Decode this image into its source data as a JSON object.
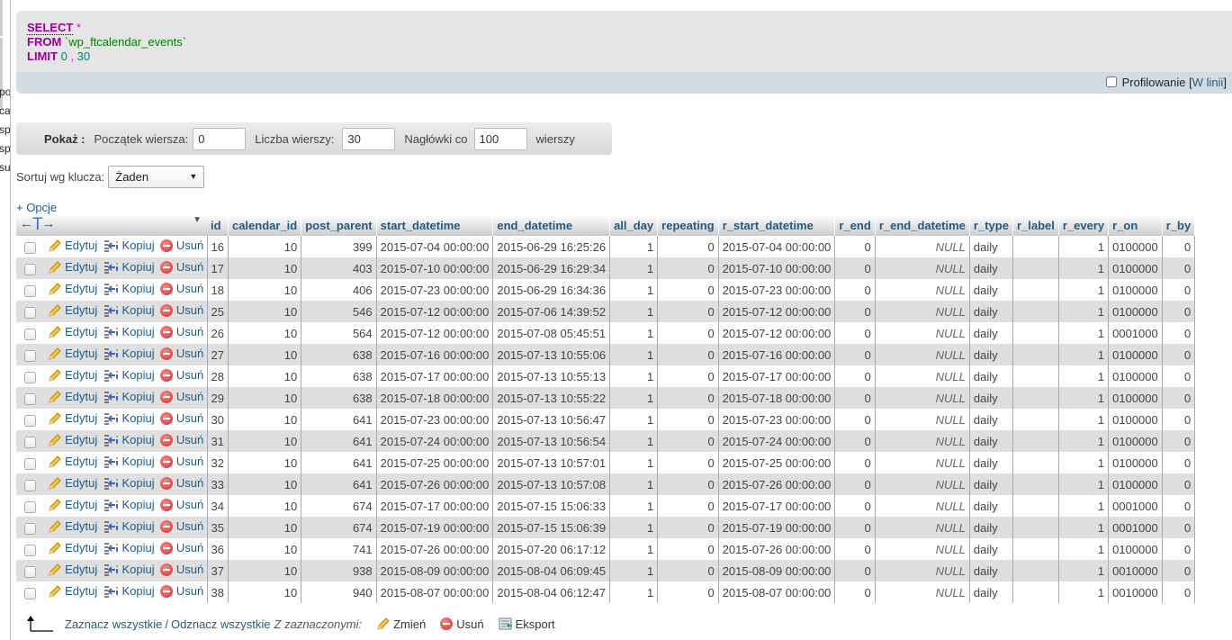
{
  "left_nav": {
    "fragments": [
      "poc",
      "cal",
      "spe",
      "spe",
      "sul"
    ]
  },
  "sql": {
    "select_kw": "SELECT",
    "star": "*",
    "from_kw": "FROM",
    "table": "`wp_ftcalendar_events`",
    "limit_kw": "LIMIT",
    "offset": "0",
    "comma": ",",
    "count": "30",
    "profiling_label": "Profilowanie",
    "inline_link": "W linii",
    "bracket_open": "[",
    "bracket_close": "]"
  },
  "navigation": {
    "show_label": "Pokaż :",
    "start_row_label": "Początek wiersza:",
    "start_row_value": "0",
    "row_count_label": "Liczba wierszy:",
    "row_count_value": "30",
    "headers_every_label": "Nagłówki co",
    "headers_every_value": "100",
    "rows_suffix": "wierszy"
  },
  "sort": {
    "label": "Sortuj wg klucza:",
    "selected": "Żaden"
  },
  "options_link": "+ Opcje",
  "table": {
    "columns": [
      "id",
      "calendar_id",
      "post_parent",
      "start_datetime",
      "end_datetime",
      "all_day",
      "repeating",
      "r_start_datetime",
      "r_end",
      "r_end_datetime",
      "r_type",
      "r_label",
      "r_every",
      "r_on",
      "r_by"
    ],
    "actions": {
      "edit": "Edytuj",
      "copy": "Kopiuj",
      "delete": "Usuń"
    },
    "rows": [
      [
        "16",
        "10",
        "399",
        "2015-07-04 00:00:00",
        "2015-06-29 16:25:26",
        "1",
        "0",
        "2015-07-04 00:00:00",
        "0",
        "NULL",
        "daily",
        "",
        "1",
        "0100000",
        "0"
      ],
      [
        "17",
        "10",
        "403",
        "2015-07-10 00:00:00",
        "2015-06-29 16:29:34",
        "1",
        "0",
        "2015-07-10 00:00:00",
        "0",
        "NULL",
        "daily",
        "",
        "1",
        "0100000",
        "0"
      ],
      [
        "18",
        "10",
        "406",
        "2015-07-23 00:00:00",
        "2015-06-29 16:34:36",
        "1",
        "0",
        "2015-07-23 00:00:00",
        "0",
        "NULL",
        "daily",
        "",
        "1",
        "0100000",
        "0"
      ],
      [
        "25",
        "10",
        "546",
        "2015-07-12 00:00:00",
        "2015-07-06 14:39:52",
        "1",
        "0",
        "2015-07-12 00:00:00",
        "0",
        "NULL",
        "daily",
        "",
        "1",
        "0100000",
        "0"
      ],
      [
        "26",
        "10",
        "564",
        "2015-07-12 00:00:00",
        "2015-07-08 05:45:51",
        "1",
        "0",
        "2015-07-12 00:00:00",
        "0",
        "NULL",
        "daily",
        "",
        "1",
        "0001000",
        "0"
      ],
      [
        "27",
        "10",
        "638",
        "2015-07-16 00:00:00",
        "2015-07-13 10:55:06",
        "1",
        "0",
        "2015-07-16 00:00:00",
        "0",
        "NULL",
        "daily",
        "",
        "1",
        "0100000",
        "0"
      ],
      [
        "28",
        "10",
        "638",
        "2015-07-17 00:00:00",
        "2015-07-13 10:55:13",
        "1",
        "0",
        "2015-07-17 00:00:00",
        "0",
        "NULL",
        "daily",
        "",
        "1",
        "0100000",
        "0"
      ],
      [
        "29",
        "10",
        "638",
        "2015-07-18 00:00:00",
        "2015-07-13 10:55:22",
        "1",
        "0",
        "2015-07-18 00:00:00",
        "0",
        "NULL",
        "daily",
        "",
        "1",
        "0100000",
        "0"
      ],
      [
        "30",
        "10",
        "641",
        "2015-07-23 00:00:00",
        "2015-07-13 10:56:47",
        "1",
        "0",
        "2015-07-23 00:00:00",
        "0",
        "NULL",
        "daily",
        "",
        "1",
        "0100000",
        "0"
      ],
      [
        "31",
        "10",
        "641",
        "2015-07-24 00:00:00",
        "2015-07-13 10:56:54",
        "1",
        "0",
        "2015-07-24 00:00:00",
        "0",
        "NULL",
        "daily",
        "",
        "1",
        "0100000",
        "0"
      ],
      [
        "32",
        "10",
        "641",
        "2015-07-25 00:00:00",
        "2015-07-13 10:57:01",
        "1",
        "0",
        "2015-07-25 00:00:00",
        "0",
        "NULL",
        "daily",
        "",
        "1",
        "0100000",
        "0"
      ],
      [
        "33",
        "10",
        "641",
        "2015-07-26 00:00:00",
        "2015-07-13 10:57:08",
        "1",
        "0",
        "2015-07-26 00:00:00",
        "0",
        "NULL",
        "daily",
        "",
        "1",
        "0100000",
        "0"
      ],
      [
        "34",
        "10",
        "674",
        "2015-07-17 00:00:00",
        "2015-07-15 15:06:33",
        "1",
        "0",
        "2015-07-17 00:00:00",
        "0",
        "NULL",
        "daily",
        "",
        "1",
        "0001000",
        "0"
      ],
      [
        "35",
        "10",
        "674",
        "2015-07-19 00:00:00",
        "2015-07-15 15:06:39",
        "1",
        "0",
        "2015-07-19 00:00:00",
        "0",
        "NULL",
        "daily",
        "",
        "1",
        "0001000",
        "0"
      ],
      [
        "36",
        "10",
        "741",
        "2015-07-26 00:00:00",
        "2015-07-20 06:17:12",
        "1",
        "0",
        "2015-07-26 00:00:00",
        "0",
        "NULL",
        "daily",
        "",
        "1",
        "0100000",
        "0"
      ],
      [
        "37",
        "10",
        "938",
        "2015-08-09 00:00:00",
        "2015-08-04 06:09:45",
        "1",
        "0",
        "2015-08-09 00:00:00",
        "0",
        "NULL",
        "daily",
        "",
        "1",
        "0010000",
        "0"
      ],
      [
        "38",
        "10",
        "940",
        "2015-08-07 00:00:00",
        "2015-08-04 06:12:47",
        "1",
        "0",
        "2015-08-07 00:00:00",
        "0",
        "NULL",
        "daily",
        "",
        "1",
        "0010000",
        "0"
      ]
    ]
  },
  "bottom": {
    "check_all": "Zaznacz wszystkie",
    "separator": "/",
    "uncheck_all": "Odznacz wszystkie",
    "with_selected": "Z zaznaczonymi:",
    "change": "Zmień",
    "delete": "Usuń",
    "export": "Eksport"
  },
  "icons": {
    "edit": "pencil-icon",
    "copy": "copy-row-icon",
    "delete": "delete-circle-icon",
    "export": "export-icon",
    "arrow": "arrow-up-left-icon"
  },
  "colors": {
    "link": "#235a81",
    "keyword": "#990099",
    "table_name": "#008000",
    "number": "#008080",
    "row_even": "#dfdfdf"
  }
}
